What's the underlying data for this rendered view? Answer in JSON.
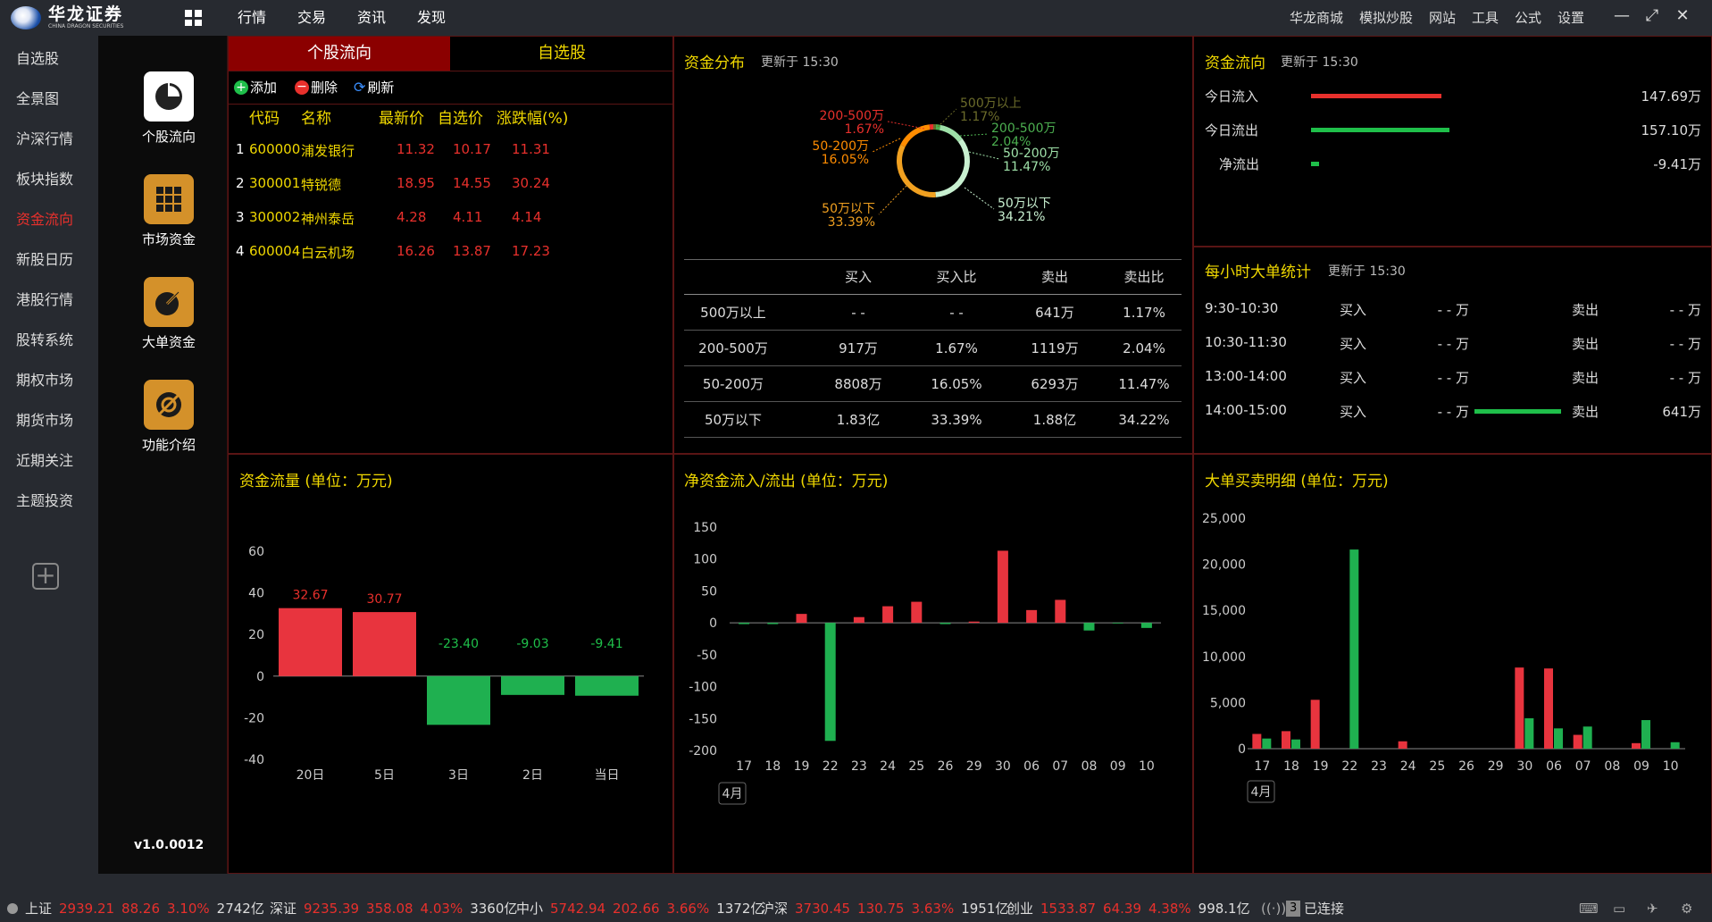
{
  "app": {
    "name": "华龙证券",
    "name_en": "CHINA DRAGON SECURITIES",
    "version": "v1.0.0012"
  },
  "topnav": [
    "行情",
    "交易",
    "资讯",
    "发现"
  ],
  "topright": [
    "华龙商城",
    "模拟炒股",
    "网站",
    "工具",
    "公式",
    "设置"
  ],
  "sidebar": [
    "自选股",
    "全景图",
    "沪深行情",
    "板块指数",
    "资金流向",
    "新股日历",
    "港股行情",
    "股转系统",
    "期权市场",
    "期货市场",
    "近期关注",
    "主题投资"
  ],
  "sidebar_active": 4,
  "iconbar": [
    {
      "label": "个股流向",
      "icon": "pie-chart-icon"
    },
    {
      "label": "市场资金",
      "icon": "grid-icon"
    },
    {
      "label": "大单资金",
      "icon": "big-order-icon"
    },
    {
      "label": "功能介绍",
      "icon": "info-icon"
    }
  ],
  "stock_panel": {
    "tabs": [
      "个股流向",
      "自选股"
    ],
    "toolbar": [
      "添加",
      "删除",
      "刷新"
    ],
    "headers": [
      "代码",
      "名称",
      "最新价",
      "自选价",
      "涨跌幅(%)"
    ],
    "rows": [
      {
        "idx": "1",
        "code": "600000",
        "name": "浦发银行",
        "last": "11.32",
        "pick": "10.17",
        "chg": "11.31"
      },
      {
        "idx": "2",
        "code": "300001",
        "name": "特锐德",
        "last": "18.95",
        "pick": "14.55",
        "chg": "30.24"
      },
      {
        "idx": "3",
        "code": "300002",
        "name": "神州泰岳",
        "last": "4.28",
        "pick": "4.11",
        "chg": "4.14"
      },
      {
        "idx": "4",
        "code": "600004",
        "name": "白云机场",
        "last": "16.26",
        "pick": "13.87",
        "chg": "17.23"
      }
    ]
  },
  "distribution": {
    "title": "资金分布",
    "updated": "更新于 15:30",
    "donut_labels": [
      {
        "name": "500万以上",
        "pct": "1.17%",
        "color": "#6b6b2a"
      },
      {
        "name": "200-500万",
        "pct": "2.04%",
        "color": "#4caf50"
      },
      {
        "name": "50-200万",
        "pct": "11.47%",
        "color": "#9ee0a8"
      },
      {
        "name": "50万以下",
        "pct": "34.21%",
        "color": "#c8f0d0"
      },
      {
        "name": "50万以下",
        "pct": "33.39%",
        "color": "#f0a020"
      },
      {
        "name": "50-200万",
        "pct": "16.05%",
        "color": "#ff8c00"
      },
      {
        "name": "200-500万",
        "pct": "1.67%",
        "color": "#e8302c"
      }
    ],
    "table_headers": [
      "",
      "买入",
      "买入比",
      "卖出",
      "卖出比"
    ],
    "table_rows": [
      [
        "500万以上",
        "- -",
        "- -",
        "641万",
        "1.17%"
      ],
      [
        "200-500万",
        "917万",
        "1.67%",
        "1119万",
        "2.04%"
      ],
      [
        "50-200万",
        "8808万",
        "16.05%",
        "6293万",
        "11.47%"
      ],
      [
        "50万以下",
        "1.83亿",
        "33.39%",
        "1.88亿",
        "34.22%"
      ]
    ]
  },
  "flow": {
    "title": "资金流向",
    "updated": "更新于 15:30",
    "rows": [
      {
        "label": "今日流入",
        "value": "147.69万",
        "fraction": 0.81,
        "color": "#e8302c"
      },
      {
        "label": "今日流出",
        "value": "157.10万",
        "fraction": 0.86,
        "color": "#1fbf4a"
      },
      {
        "label": "净流出",
        "value": "-9.41万",
        "fraction": 0.05,
        "color": "#1fbf4a"
      }
    ]
  },
  "hourly": {
    "title": "每小时大单统计",
    "updated": "更新于 15:30",
    "buy_label": "买入",
    "sell_label": "卖出",
    "rows": [
      {
        "time": "9:30-10:30",
        "buy": "- - 万",
        "sell": "- - 万",
        "sell_bar": 0
      },
      {
        "time": "10:30-11:30",
        "buy": "- - 万",
        "sell": "- - 万",
        "sell_bar": 0
      },
      {
        "time": "13:00-14:00",
        "buy": "- - 万",
        "sell": "- - 万",
        "sell_bar": 0
      },
      {
        "time": "14:00-15:00",
        "buy": "- - 万",
        "sell": "641万",
        "sell_bar": 1
      }
    ]
  },
  "chart_data": [
    {
      "type": "bar",
      "title": "资金流量 (单位：万元)",
      "categories": [
        "20日",
        "5日",
        "3日",
        "2日",
        "当日"
      ],
      "values": [
        32.67,
        30.77,
        -23.4,
        -9.03,
        -9.41
      ],
      "labels": [
        "32.67",
        "30.77",
        "-23.40",
        "-9.03",
        "-9.41"
      ],
      "yticks": [
        60,
        40,
        20,
        0,
        -20,
        -40
      ],
      "ylim": [
        -40,
        60
      ]
    },
    {
      "type": "bar",
      "title": "净资金流入/流出 (单位：万元)",
      "categories": [
        "17",
        "18",
        "19",
        "22",
        "23",
        "24",
        "25",
        "26",
        "29",
        "30",
        "06",
        "07",
        "08",
        "09",
        "10"
      ],
      "values": [
        -2,
        -2,
        14,
        -185,
        9,
        26,
        33,
        -2,
        2,
        113,
        20,
        36,
        -12,
        -1,
        -8
      ],
      "yticks": [
        150,
        100,
        50,
        0,
        -50,
        -100,
        -150,
        -200
      ],
      "ylim": [
        -200,
        150
      ],
      "month_label": "4月"
    },
    {
      "type": "bar",
      "title": "大单买卖明细 (单位：万元)",
      "categories": [
        "17",
        "18",
        "19",
        "22",
        "23",
        "24",
        "25",
        "26",
        "29",
        "30",
        "06",
        "07",
        "08",
        "09",
        "10"
      ],
      "series": [
        {
          "name": "买入",
          "values": [
            1600,
            1900,
            5300,
            0,
            0,
            800,
            0,
            0,
            0,
            8800,
            8700,
            1500,
            0,
            600,
            0
          ]
        },
        {
          "name": "卖出",
          "values": [
            1100,
            1000,
            0,
            21600,
            0,
            0,
            0,
            0,
            0,
            3300,
            2200,
            2400,
            0,
            3100,
            700
          ]
        }
      ],
      "yticks": [
        "25,000",
        "20,000",
        "15,000",
        "10,000",
        "5,000",
        "0"
      ],
      "ylim": [
        0,
        25000
      ],
      "month_label": "4月"
    }
  ],
  "statusbar": [
    {
      "name": "上证",
      "price": "2939.21",
      "chg": "88.26",
      "pct": "3.10%",
      "vol": "2742亿"
    },
    {
      "name": "深证",
      "price": "9235.39",
      "chg": "358.08",
      "pct": "4.03%",
      "vol": "3360亿"
    },
    {
      "name": "中小",
      "price": "5742.94",
      "chg": "202.66",
      "pct": "3.66%",
      "vol": "1372亿"
    },
    {
      "name": "沪深",
      "price": "3730.45",
      "chg": "130.75",
      "pct": "3.63%",
      "vol": "1951亿"
    },
    {
      "name": "创业",
      "price": "1533.87",
      "chg": "64.39",
      "pct": "4.38%",
      "vol": "998.1亿"
    }
  ],
  "connection": {
    "count": "3",
    "status": "已连接"
  }
}
